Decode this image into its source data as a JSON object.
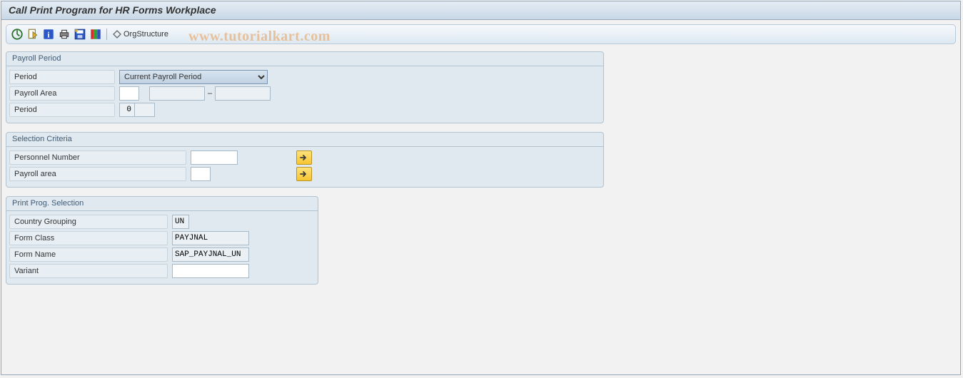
{
  "window": {
    "title": "Call Print Program for HR Forms Workplace"
  },
  "toolbar": {
    "org_label": "OrgStructure"
  },
  "watermark": "www.tutorialkart.com",
  "group1": {
    "title": "Payroll Period",
    "period_label": "Period",
    "period_combo_selected": "Current Payroll Period",
    "payroll_area_label": "Payroll Area",
    "payroll_area_value": "",
    "range_from": "",
    "range_to": "",
    "period2_label": "Period",
    "period2_value": "0",
    "period2_extra": ""
  },
  "group2": {
    "title": "Selection Criteria",
    "personnel_number_label": "Personnel Number",
    "personnel_number_value": "",
    "payroll_area_label": "Payroll area",
    "payroll_area_value": ""
  },
  "group3": {
    "title": "Print Prog. Selection",
    "country_grouping_label": "Country Grouping",
    "country_grouping_value": "UN",
    "form_class_label": "Form Class",
    "form_class_value": "PAYJNAL",
    "form_name_label": "Form Name",
    "form_name_value": "SAP_PAYJNAL_UN",
    "variant_label": "Variant",
    "variant_value": ""
  }
}
